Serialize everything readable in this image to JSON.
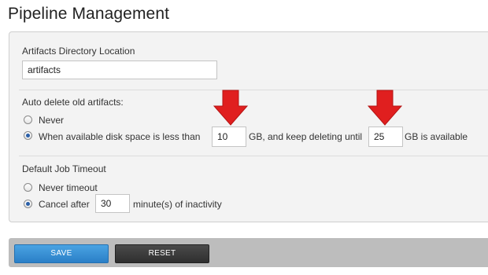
{
  "page": {
    "title": "Pipeline Management"
  },
  "artifacts_dir": {
    "label": "Artifacts Directory Location",
    "value": "artifacts"
  },
  "auto_delete": {
    "label": "Auto delete old artifacts:",
    "never_label": "Never",
    "when_prefix": "When available disk space is less than",
    "min_gb": "10",
    "middle_text": "GB, and keep deleting until",
    "target_gb": "25",
    "suffix": "GB is available",
    "selected": "when"
  },
  "job_timeout": {
    "label": "Default Job Timeout",
    "never_label": "Never timeout",
    "cancel_prefix": "Cancel after",
    "minutes": "30",
    "suffix": "minute(s) of inactivity",
    "selected": "cancel"
  },
  "buttons": {
    "save": "SAVE",
    "reset": "RESET"
  },
  "colors": {
    "arrow": "#e01f1f",
    "save": "#3b93d8",
    "reset": "#3a3a3a"
  },
  "icons": {
    "annotation": "down-arrow-icon"
  }
}
